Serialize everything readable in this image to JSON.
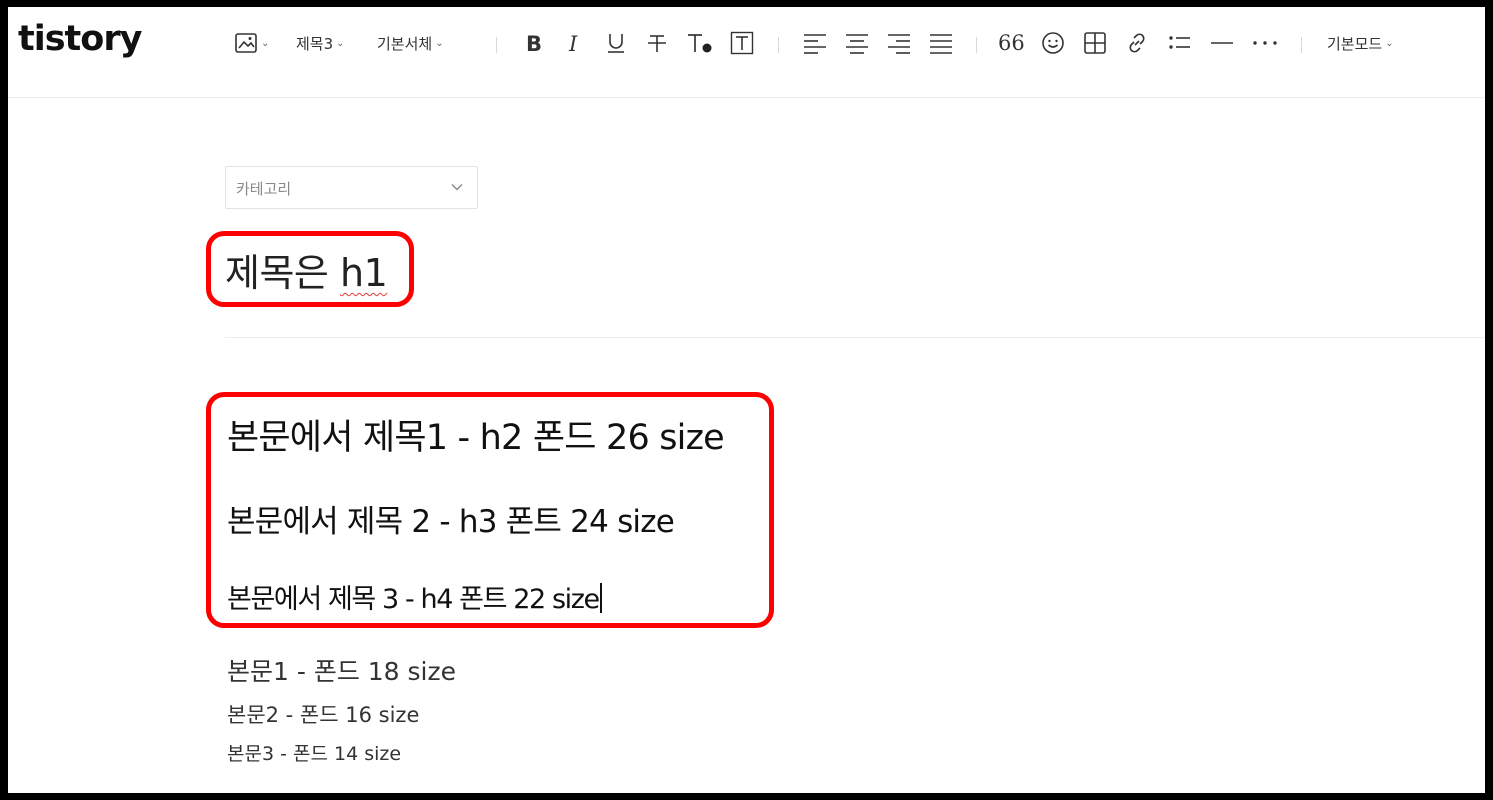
{
  "app": {
    "logo": "tistory"
  },
  "toolbar": {
    "heading_select": "제목3",
    "font_select": "기본서체",
    "strike_glyph": "干",
    "text_color_glyph": "T",
    "quote_glyph": "66",
    "mode_select": "기본모드",
    "icons": [
      "image-icon",
      "bold-icon",
      "italic-icon",
      "underline-icon",
      "strikethrough-icon",
      "text-color-icon",
      "text-background-icon",
      "align-left-icon",
      "align-center-icon",
      "align-right-icon",
      "align-justify-icon",
      "quote-icon",
      "emoji-icon",
      "table-icon",
      "link-icon",
      "list-icon",
      "horizontal-rule-icon",
      "more-icon"
    ]
  },
  "editor": {
    "category_placeholder": "카테고리",
    "title_prefix": "제목은",
    "title_misspelled": "h1",
    "headings": [
      "본문에서 제목1 - h2 폰드 26 size",
      "본문에서 제목 2 - h3 폰트 24 size",
      "본문에서 제목 3 - h4 폰트 22 size"
    ],
    "paragraphs": [
      "본문1 - 폰드 18 size",
      "본문2 - 폰드 16 size",
      "본문3 - 폰드 14 size"
    ]
  },
  "annotations": {
    "highlight_color": "#ff0000"
  }
}
